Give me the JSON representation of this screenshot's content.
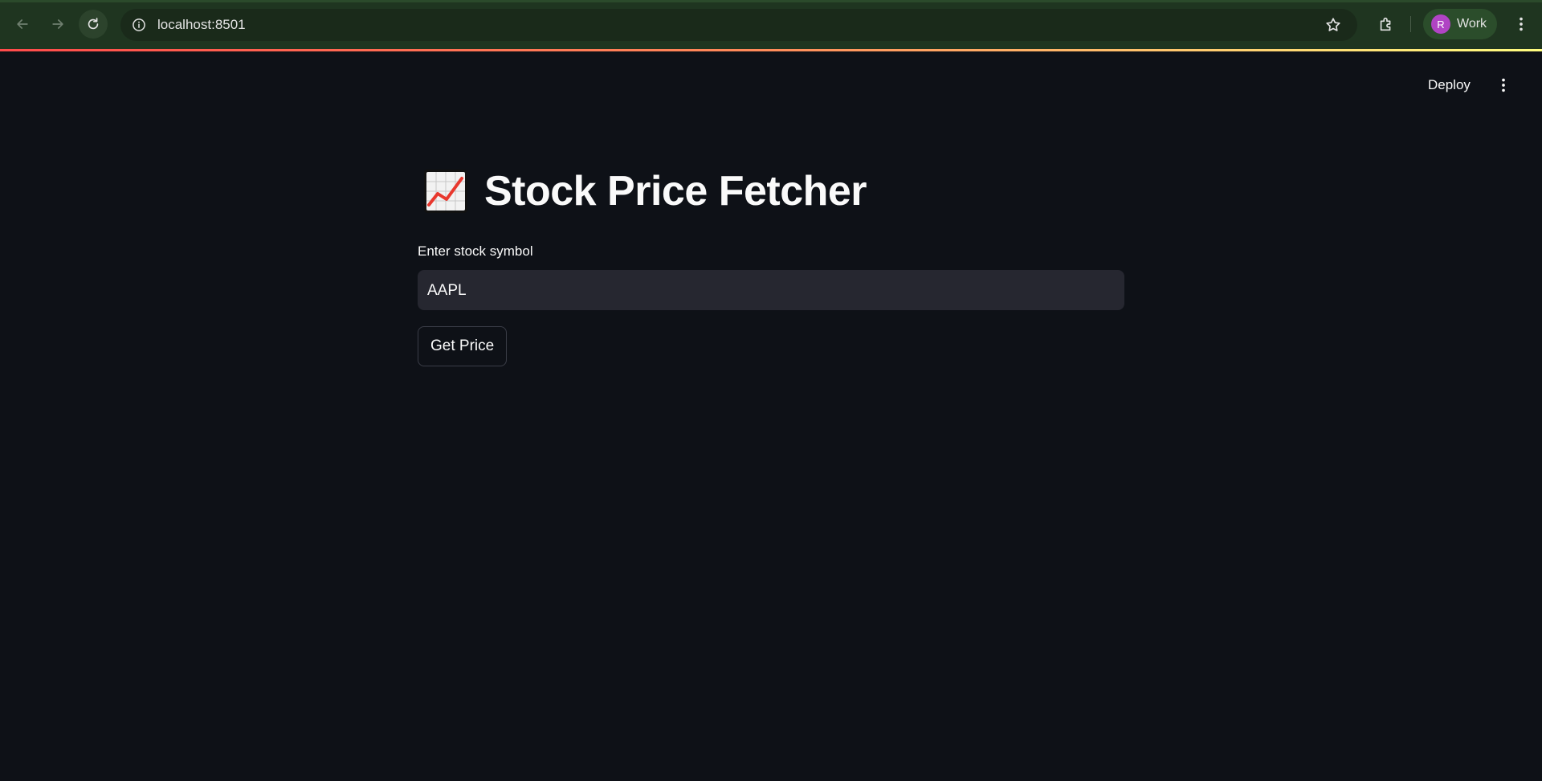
{
  "browser": {
    "url": "localhost:8501",
    "profile": {
      "initial": "R",
      "label": "Work",
      "avatar_color": "#b044c4"
    },
    "icons": [
      "back-icon",
      "forward-icon",
      "reload-icon",
      "site-info-icon",
      "bookmark-star-icon",
      "extensions-icon",
      "chrome-menu-icon"
    ]
  },
  "app": {
    "deploy_label": "Deploy",
    "title": "Stock Price Fetcher",
    "title_icon": "chart-increasing-emoji",
    "input": {
      "label": "Enter stock symbol",
      "value": "AAPL"
    },
    "button_label": "Get Price"
  },
  "colors": {
    "background": "#0e1117",
    "input_bg": "#262730",
    "text": "#fafafa",
    "chrome_bg": "#1f3520",
    "decoration_gradient": [
      "#ff4b4b",
      "#fffd80"
    ]
  }
}
